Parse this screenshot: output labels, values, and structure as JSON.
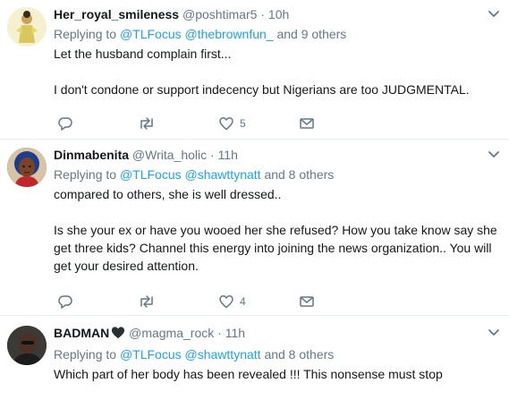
{
  "tweets": [
    {
      "name": "Her_royal_smileness",
      "handle": "@poshtimar5",
      "separator": "·",
      "time": "10h",
      "replying_prefix": "Replying to",
      "mentions": [
        "@TLFocus",
        "@thebrownfun_"
      ],
      "others": "and 9 others",
      "body": [
        "Let the husband complain first...",
        "I don't condone or support indecency but Nigerians are too JUDGMENTAL."
      ],
      "reply_count": "",
      "retweet_count": "",
      "like_count": "5"
    },
    {
      "name": "Dinmabenita",
      "handle": "@Writa_holic",
      "separator": "·",
      "time": "11h",
      "replying_prefix": "Replying to",
      "mentions": [
        "@TLFocus",
        "@shawttynatt"
      ],
      "others": "and 8 others",
      "body": [
        "compared to others, she is well dressed..",
        "Is she your ex or have you wooed her she refused?  How you take know say she get three kids? Channel this energy into joining the news organization.. You will get your desired attention."
      ],
      "reply_count": "",
      "retweet_count": "",
      "like_count": "4"
    },
    {
      "name": "BADMAN",
      "handle": "@magma_rock",
      "separator": "·",
      "time": "11h",
      "replying_prefix": "Replying to",
      "mentions": [
        "@TLFocus",
        "@shawttynatt"
      ],
      "others": "and 8 others",
      "body": [
        "Which part of her body has been revealed !!! This nonsense must stop"
      ]
    }
  ],
  "icons": {
    "reply": "reply-icon",
    "retweet": "retweet-icon",
    "like": "heart-icon",
    "message": "envelope-icon",
    "more": "chevron-down-icon",
    "name_heart": "black-heart-icon"
  },
  "colors": {
    "text": "#14171a",
    "muted": "#657786",
    "link": "#1da1f2",
    "divider": "#e6ecf0"
  }
}
